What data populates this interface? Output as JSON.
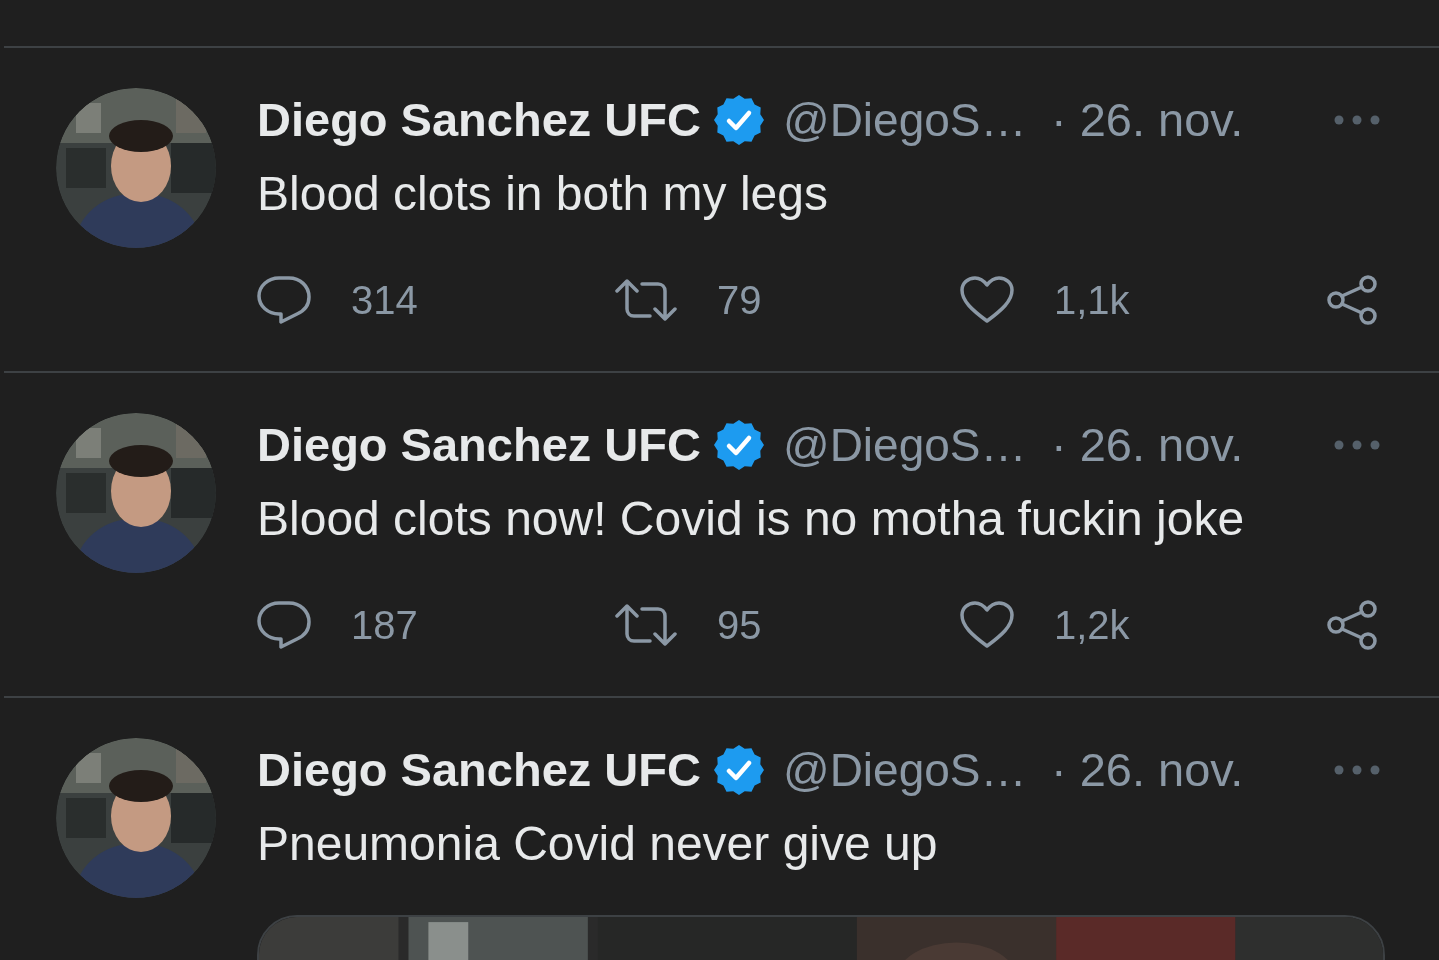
{
  "tweets": [
    {
      "name": "Diego Sanchez UFC",
      "verified": true,
      "handle": "@DiegoS…",
      "time": "· 26. nov.",
      "text": "Blood clots in both my legs",
      "replies": "314",
      "retweets": "79",
      "likes": "1,1k"
    },
    {
      "name": "Diego Sanchez UFC",
      "verified": true,
      "handle": "@DiegoS…",
      "time": "· 26. nov.",
      "text": "Blood clots now! Covid is no motha fuckin joke",
      "replies": "187",
      "retweets": "95",
      "likes": "1,2k"
    },
    {
      "name": "Diego Sanchez UFC",
      "verified": true,
      "handle": "@DiegoS…",
      "time": "· 26. nov.",
      "text": "Pneumonia Covid never give up"
    }
  ]
}
